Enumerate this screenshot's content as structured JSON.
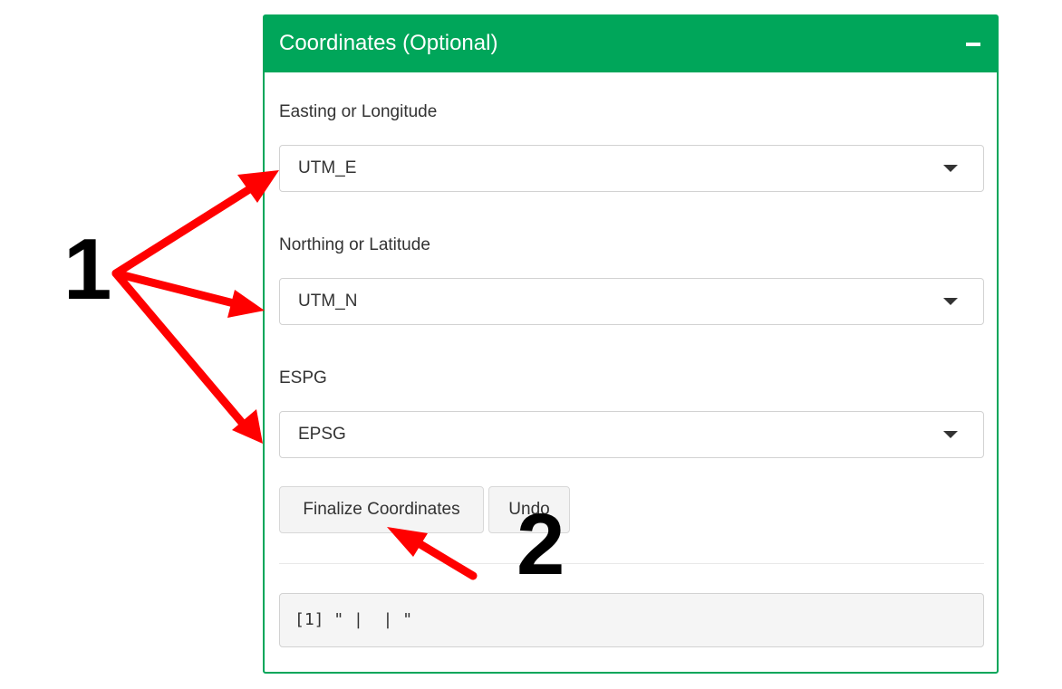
{
  "panel": {
    "title": "Coordinates (Optional)",
    "collapse_glyph": "−"
  },
  "fields": [
    {
      "label": "Easting or Longitude",
      "value": "UTM_E"
    },
    {
      "label": "Northing or Latitude",
      "value": "UTM_N"
    },
    {
      "label": "ESPG",
      "value": "EPSG"
    }
  ],
  "buttons": {
    "finalize_label": "Finalize Coordinates",
    "undo_label": "Undo"
  },
  "output": {
    "text": "[1] \" |  | \""
  },
  "annotations": {
    "marker_1": "1",
    "marker_2": "2",
    "arrow_color": "#ff0000"
  },
  "colors": {
    "header_green": "#00a65a",
    "panel_border": "#00a65a"
  },
  "icons": {
    "collapse": "minus-icon",
    "dropdown": "chevron-down-icon",
    "annotation_arrow": "arrow-icon"
  }
}
